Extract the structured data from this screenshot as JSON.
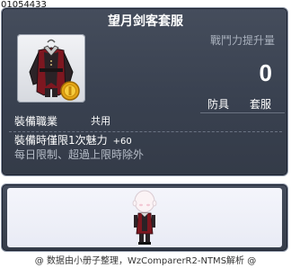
{
  "item": {
    "id": "01054433",
    "name": "望月剑客套服",
    "icon": "red-black-overcoat-icon",
    "badge_icon": "gold-coin-icon"
  },
  "power": {
    "label": "戰鬥力提升量",
    "value": "0"
  },
  "tags": [
    "防具",
    "套服"
  ],
  "job": {
    "label": "裝備職業",
    "value": "共用"
  },
  "effect": {
    "text": "裝備時僅限1次魅力",
    "value": "+60"
  },
  "limit_text": "每日限制、超過上限時除外",
  "preview": {
    "icon": "character-preview-icon"
  },
  "footer": {
    "text": "@ 数据由小册子整理，WzComparerR2-NTMS解析 @"
  },
  "colors": {
    "panel": "#3d4554",
    "panel_border": "#8f98a8",
    "label_grey": "#a8b0bc",
    "coat_red": "#8a1a22"
  }
}
